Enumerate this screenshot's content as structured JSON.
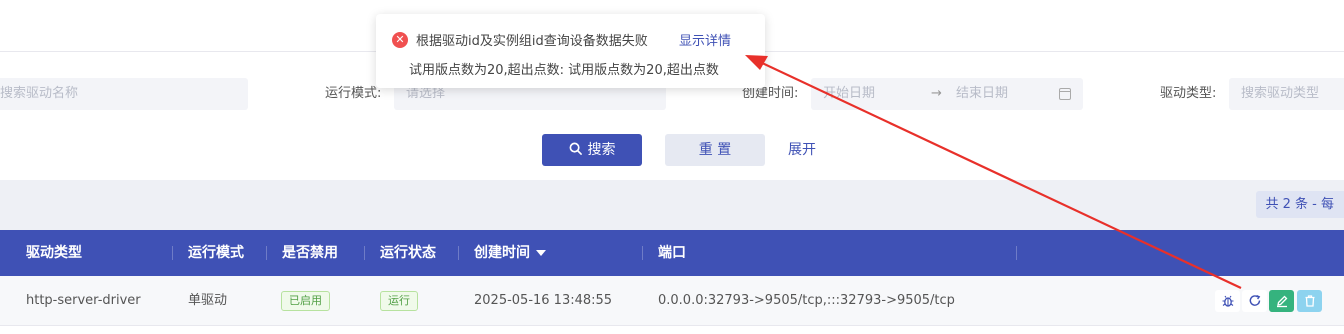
{
  "filters": {
    "driver_name": {
      "placeholder": "搜索驱动名称"
    },
    "run_mode": {
      "label": "运行模式:",
      "placeholder": "请选择"
    },
    "create_time": {
      "label": "创建时间:",
      "start_placeholder": "开始日期",
      "separator": "→",
      "end_placeholder": "结束日期"
    },
    "driver_type": {
      "label": "驱动类型:",
      "placeholder": "搜索驱动类型"
    },
    "search_label": "搜索",
    "reset_label": "重 置",
    "expand_label": "展开"
  },
  "pagination": {
    "total_text": "共 2 条 - 每"
  },
  "table": {
    "columns": [
      "驱动类型",
      "运行模式",
      "是否禁用",
      "运行状态",
      "创建时间",
      "端口"
    ],
    "rows": [
      {
        "driver_type": "http-server-driver",
        "run_mode": "单驱动",
        "disabled": "已启用",
        "status": "运行",
        "created": "2025-05-16 13:48:55",
        "port": "0.0.0.0:32793->9505/tcp,:::32793->9505/tcp"
      }
    ]
  },
  "toast": {
    "title": "根据驱动id及实例组id查询设备数据失败",
    "link": "显示详情",
    "detail": "试用版点数为20,超出点数: 试用版点数为20,超出点数"
  },
  "colors": {
    "primary": "#3f51b5",
    "error": "#f05050",
    "success": "#52a046",
    "annotation_arrow": "#e8302a"
  }
}
